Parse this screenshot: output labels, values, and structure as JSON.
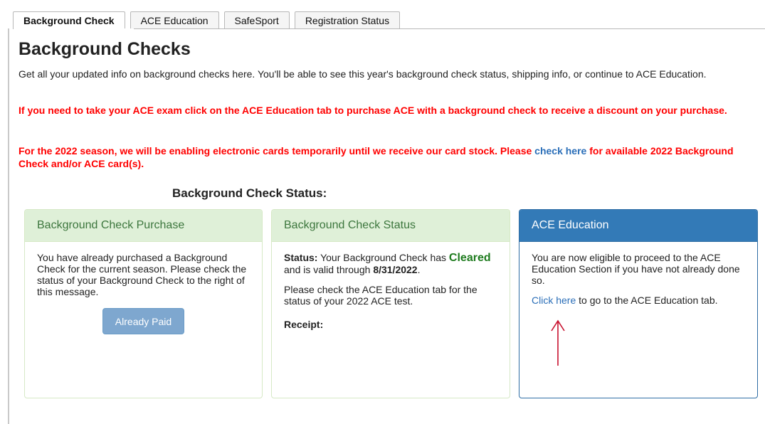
{
  "tabs": [
    {
      "label": "Background Check",
      "active": true
    },
    {
      "label": "ACE Education",
      "active": false
    },
    {
      "label": "SafeSport",
      "active": false
    },
    {
      "label": "Registration Status",
      "active": false
    }
  ],
  "page": {
    "title": "Background Checks",
    "intro": "Get all your updated info on background checks here. You'll be able to see this year's background check status, shipping info, or continue to ACE Education.",
    "warning1": "If you need to take your ACE exam click on the ACE Education tab to purchase ACE with a background check to receive a discount on your purchase.",
    "warning2_pre": "For the 2022 season, we will be enabling electronic cards temporarily until we receive our card stock. Please ",
    "warning2_link": "check here",
    "warning2_post": " for available 2022 Background Check and/or ACE card(s).",
    "status_heading": "Background Check Status:"
  },
  "panels": {
    "purchase": {
      "title": "Background Check Purchase",
      "body": "You have already purchased a Background Check for the current season. Please check the status of your Background Check to the right of this message.",
      "button_label": "Already Paid"
    },
    "status": {
      "title": "Background Check Status",
      "status_label": "Status:",
      "status_pre": " Your Background Check has ",
      "status_value": "Cleared",
      "status_mid": " and is valid through ",
      "valid_date": "8/31/2022",
      "status_end": ".",
      "note": "Please check the ACE Education tab for the status of your 2022 ACE test.",
      "receipt_label": "Receipt:"
    },
    "ace": {
      "title": "ACE Education",
      "body": "You are now eligible to proceed to the ACE Education Section if you have not already done so.",
      "link": "Click here",
      "link_post": " to go to the ACE Education tab."
    }
  },
  "colors": {
    "warning": "#ff0000",
    "link": "#2a6eb8",
    "cleared": "#1e7b1e",
    "panel_green": "#dff0d8",
    "panel_blue": "#337ab7",
    "annotation_arrow": "#c8102e"
  },
  "icons": {
    "annotation": "up-arrow-icon"
  }
}
